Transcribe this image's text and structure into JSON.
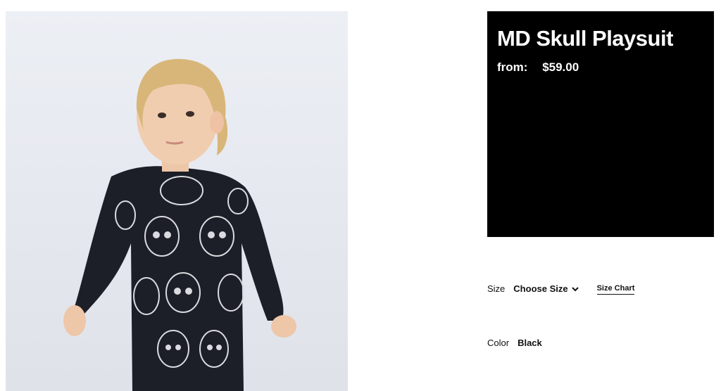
{
  "product": {
    "title": "MD Skull Playsuit",
    "price_prefix": "from:",
    "price": "$59.00"
  },
  "options": {
    "size_label": "Size",
    "size_value": "Choose Size",
    "size_chart_link": "Size Chart",
    "color_label": "Color",
    "color_value": "Black"
  },
  "colors": {
    "info_box_bg": "#000000",
    "info_box_text": "#ffffff",
    "garment": "#1a1d24"
  },
  "photo": {
    "subject": "toddler wearing black long-sleeve playsuit with white skull print"
  }
}
